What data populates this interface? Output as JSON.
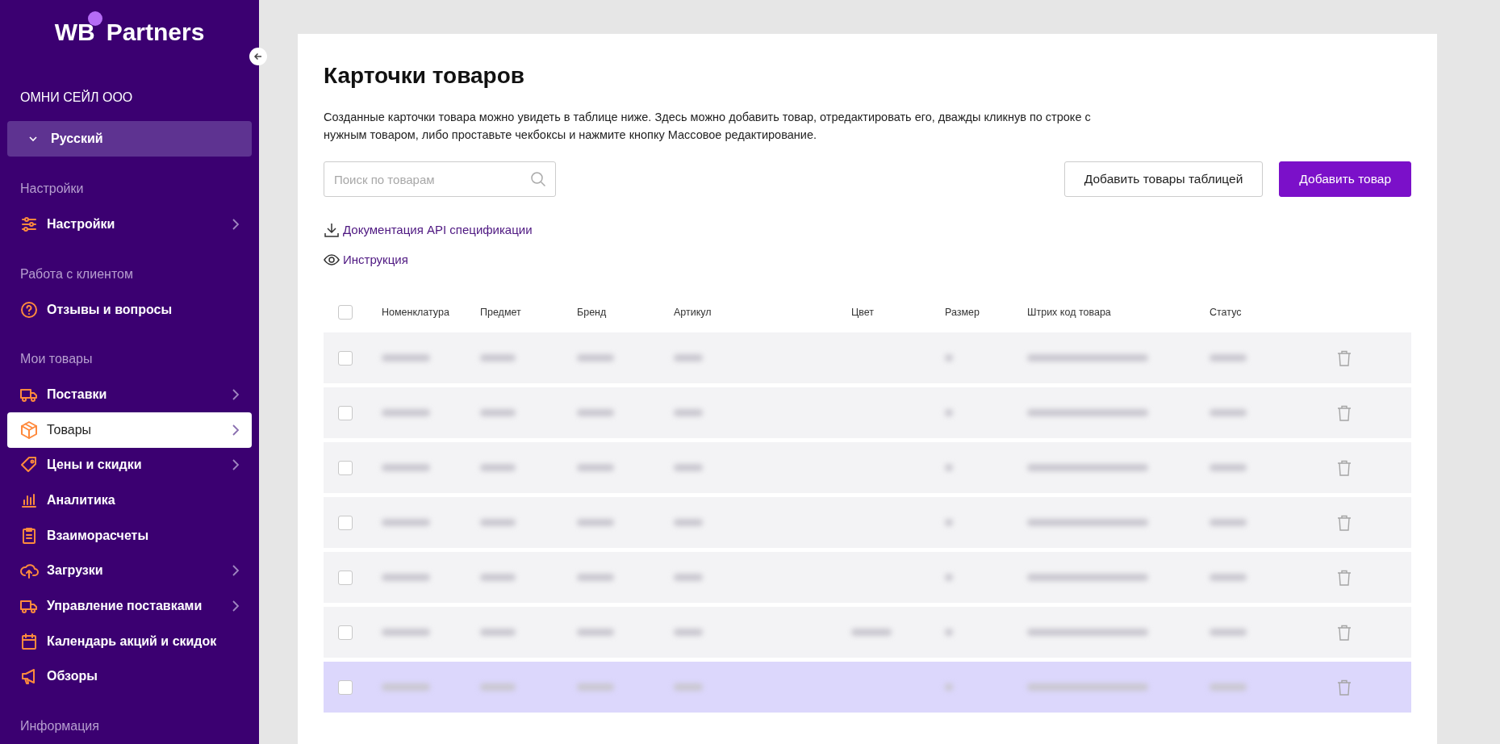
{
  "sidebar": {
    "logo_left": "WB",
    "logo_right": "Partners",
    "company": "ОМНИ СЕЙЛ ООО",
    "language": "Русский",
    "sections": [
      {
        "title": "Настройки",
        "items": [
          {
            "label": "Настройки",
            "has_arrow": true,
            "selected": false
          }
        ]
      },
      {
        "title": "Работа с клиентом",
        "items": [
          {
            "label": "Отзывы и вопросы",
            "has_arrow": false,
            "selected": false
          }
        ]
      },
      {
        "title": "Мои товары",
        "items": [
          {
            "label": "Поставки",
            "has_arrow": true,
            "selected": false
          },
          {
            "label": "Товары",
            "has_arrow": true,
            "selected": true
          },
          {
            "label": "Цены и скидки",
            "has_arrow": true,
            "selected": false
          },
          {
            "label": "Аналитика",
            "has_arrow": false,
            "selected": false
          },
          {
            "label": "Взаиморасчеты",
            "has_arrow": false,
            "selected": false
          },
          {
            "label": "Загрузки",
            "has_arrow": true,
            "selected": false
          },
          {
            "label": "Управление поставками",
            "has_arrow": true,
            "selected": false
          },
          {
            "label": "Календарь акций и скидок",
            "has_arrow": false,
            "selected": false
          },
          {
            "label": "Обзоры",
            "has_arrow": false,
            "selected": false
          }
        ]
      },
      {
        "title": "Информация"
      }
    ]
  },
  "page": {
    "title": "Карточки товаров",
    "description": "Созданные карточки товара можно увидеть в таблице ниже. Здесь можно добавить товар, отредактировать его, дважды кликнув по строке с нужным товаром, либо проставьте чекбоксы и нажмите кнопку Массовое редактирование.",
    "search": {
      "placeholder": "Поиск по товарам"
    },
    "buttons": [
      {
        "label": "Добавить товары таблицей",
        "kind": "secondary"
      },
      {
        "label": "Добавить товар",
        "kind": "primary"
      }
    ],
    "links": [
      {
        "label": "Документация API спецификации"
      },
      {
        "label": "Инструкция"
      }
    ]
  },
  "table": {
    "columns": [
      "Номенклатура",
      "Предмет",
      "Бренд",
      "Артикул",
      "Цвет",
      "Размер",
      "Штрих код товара",
      "Статус"
    ],
    "header_checked": false,
    "rows": [
      {
        "checked": false,
        "highlighted": false,
        "color_shown": false
      },
      {
        "checked": false,
        "highlighted": false,
        "color_shown": false
      },
      {
        "checked": false,
        "highlighted": false,
        "color_shown": false
      },
      {
        "checked": false,
        "highlighted": false,
        "color_shown": false
      },
      {
        "checked": false,
        "highlighted": false,
        "color_shown": false
      },
      {
        "checked": false,
        "highlighted": false,
        "color_shown": true
      },
      {
        "checked": false,
        "highlighted": true,
        "color_shown": false
      }
    ]
  }
}
